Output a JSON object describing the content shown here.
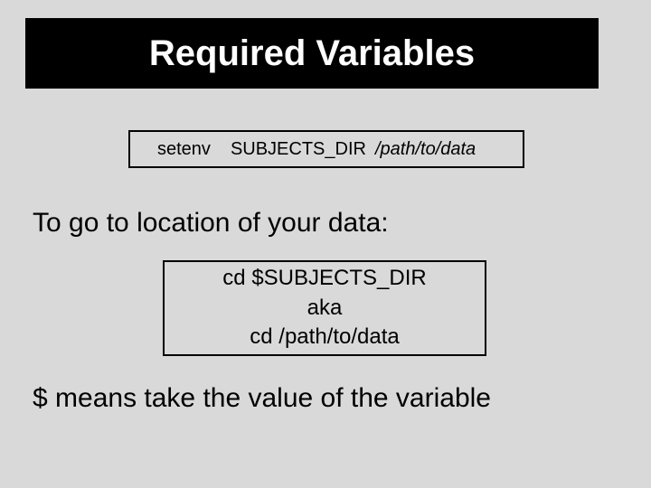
{
  "title": "Required Variables",
  "setenv_box": {
    "command": "setenv",
    "variable": "SUBJECTS_DIR",
    "path": "/path/to/data"
  },
  "body1": "To go to location of your data:",
  "cd_box": {
    "line1": "cd   $SUBJECTS_DIR",
    "line2": "aka",
    "line3": "cd   /path/to/data"
  },
  "body2": "$ means take the value of the variable"
}
